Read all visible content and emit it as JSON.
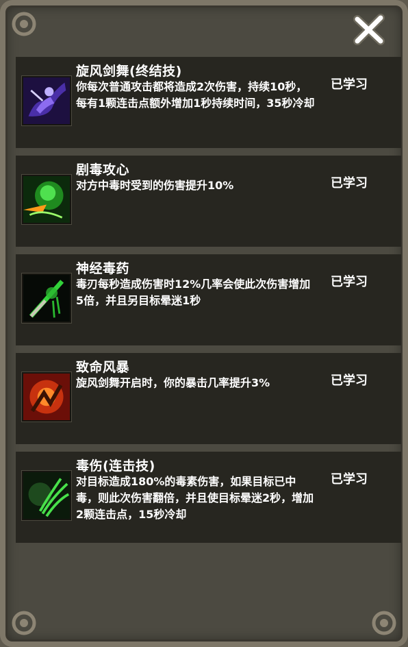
{
  "skills": [
    {
      "name": "旋风剑舞(终结技)",
      "description": "你每次普通攻击都将造成2次伤害，持续10秒，每有1颗连击点额外增加1秒持续时间，35秒冷却",
      "status": "已学习",
      "icon": "whirlwind-blades-icon"
    },
    {
      "name": "剧毒攻心",
      "description": "对方中毒时受到的伤害提升10%",
      "status": "已学习",
      "icon": "deadly-poison-icon"
    },
    {
      "name": "神经毒药",
      "description": "毒刃每秒造成伤害时12%几率会使此次伤害增加5倍，并且另目标晕迷1秒",
      "status": "已学习",
      "icon": "nerve-toxin-icon"
    },
    {
      "name": "致命风暴",
      "description": "旋风剑舞开启时，你的暴击几率提升3%",
      "status": "已学习",
      "icon": "fatal-storm-icon"
    },
    {
      "name": "毒伤(连击技)",
      "description": "对目标造成180%的毒素伤害，如果目标已中毒，则此次伤害翻倍，并且使目标晕迷2秒，增加2颗连击点，15秒冷却",
      "status": "已学习",
      "icon": "poison-wound-icon"
    }
  ]
}
